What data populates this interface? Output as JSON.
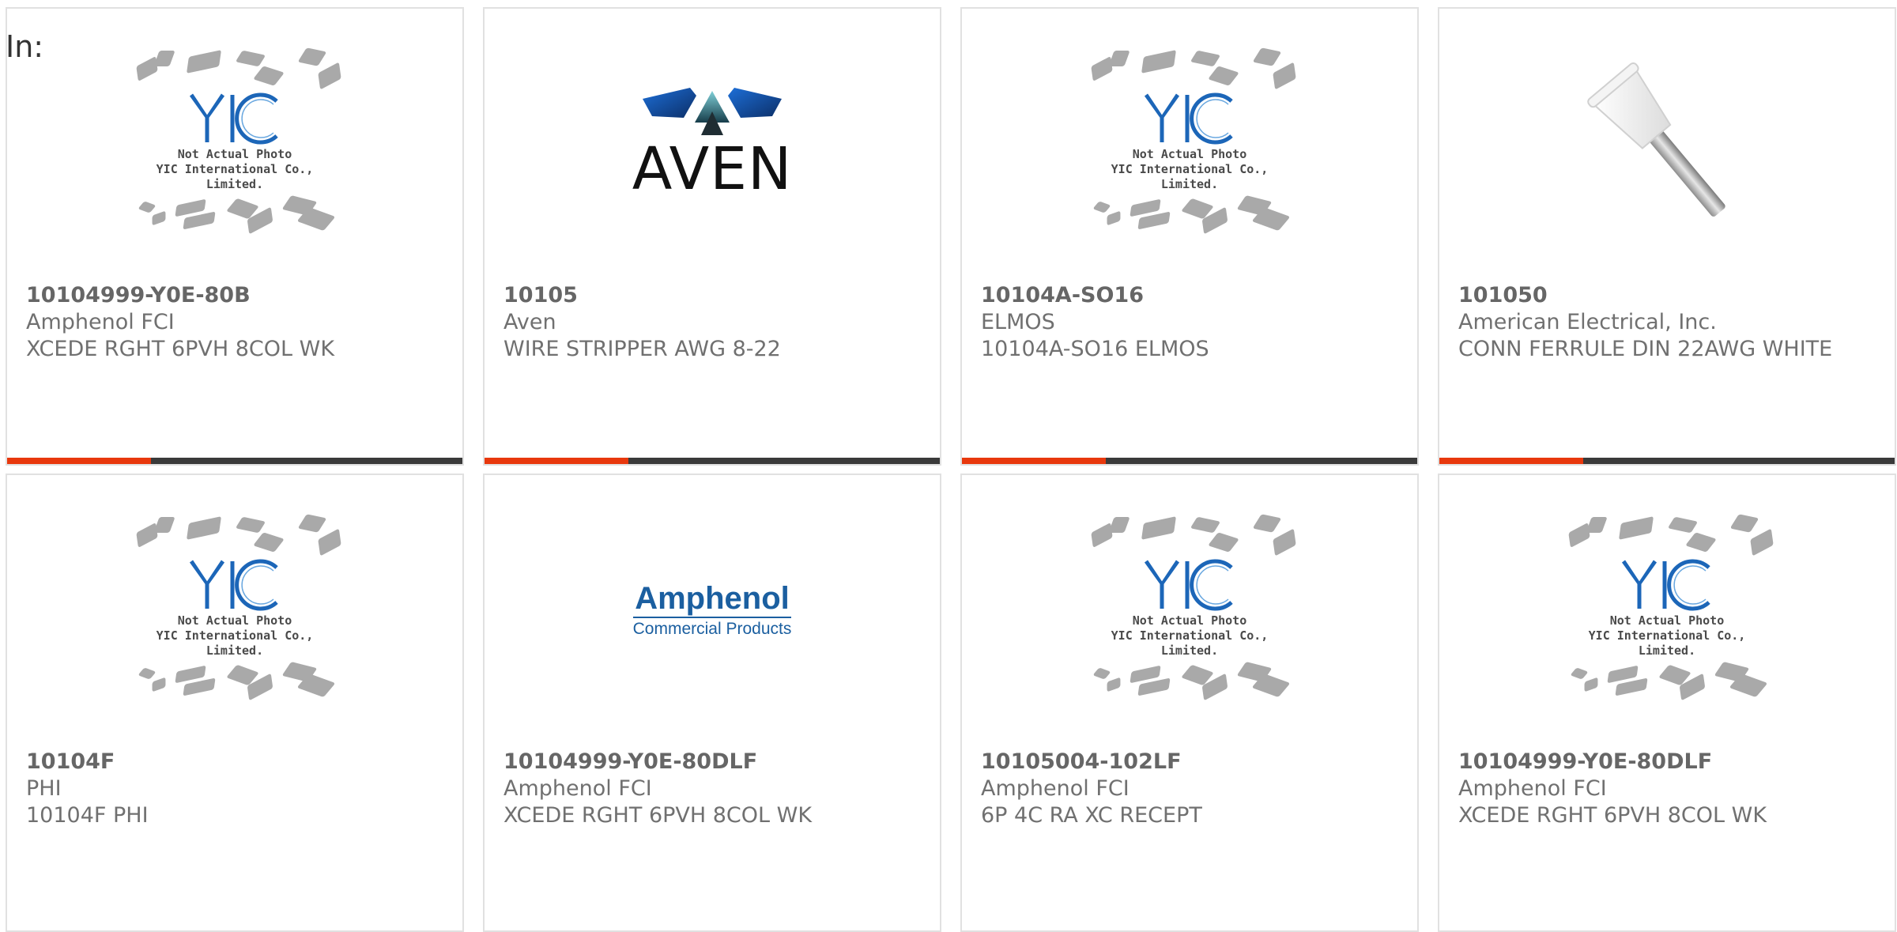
{
  "header": {
    "in_label": "In:"
  },
  "placeholder": {
    "line1": "Not Actual Photo",
    "line2": "YIC International Co., Limited."
  },
  "brand_logos": {
    "aven": "AVEN",
    "amphenol": "Amphenol",
    "amphenol_sub": "Commercial Products"
  },
  "colors": {
    "accent": "#e8380d",
    "bar": "#3a3a3a",
    "text": "#707070"
  },
  "products": [
    {
      "part_number": "10104999-Y0E-80B",
      "manufacturer": "Amphenol FCI",
      "description": "XCEDE RGHT 6PVH 8COL WK",
      "image": "yic-placeholder"
    },
    {
      "part_number": "10105",
      "manufacturer": "Aven",
      "description": "WIRE STRIPPER AWG 8-22",
      "image": "aven-logo"
    },
    {
      "part_number": "10104A-SO16",
      "manufacturer": "ELMOS",
      "description": "10104A-SO16 ELMOS",
      "image": "yic-placeholder"
    },
    {
      "part_number": "101050",
      "manufacturer": "American Electrical, Inc.",
      "description": "CONN FERRULE DIN 22AWG WHITE",
      "image": "ferrule-photo"
    },
    {
      "part_number": "10104F",
      "manufacturer": "PHI",
      "description": "10104F PHI",
      "image": "yic-placeholder"
    },
    {
      "part_number": "10104999-Y0E-80DLF",
      "manufacturer": "Amphenol FCI",
      "description": "XCEDE RGHT 6PVH 8COL WK",
      "image": "amphenol-logo"
    },
    {
      "part_number": "10105004-102LF",
      "manufacturer": "Amphenol FCI",
      "description": "6P 4C RA XC RECEPT",
      "image": "yic-placeholder"
    },
    {
      "part_number": "10104999-Y0E-80DLF",
      "manufacturer": "Amphenol FCI",
      "description": "XCEDE RGHT 6PVH 8COL WK",
      "image": "yic-placeholder"
    }
  ]
}
